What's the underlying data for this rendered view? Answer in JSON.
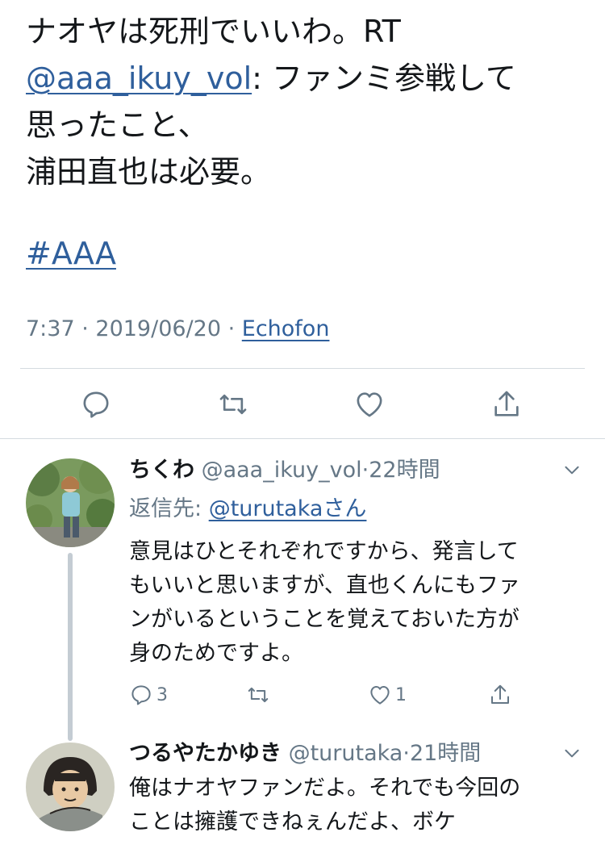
{
  "tweet": {
    "text_line1": "ナオヤは死刑でいいわ。RT",
    "mention": "@aaa_ikuy_vol",
    "text_line2_rest": ": ファンミ参戦して",
    "text_line3": "思ったこと、",
    "text_line4": "浦田直也は必要。",
    "hashtag": "#AAA",
    "time": "7:37",
    "sep1": " · ",
    "date": "2019/06/20",
    "sep2": " · ",
    "via": "Echofon"
  },
  "actions": {
    "reply_icon": "reply-icon",
    "retweet_icon": "retweet-icon",
    "like_icon": "heart-icon",
    "share_icon": "share-icon"
  },
  "replies": [
    {
      "name": "ちくわ",
      "handle": "@aaa_ikuy_vol",
      "dot": "·",
      "time": "22時間",
      "replying_prefix": "返信先: ",
      "replying_to": "@turutakaさん",
      "lines": [
        "意見はひとそれぞれですから、発言して",
        "もいいと思いますが、直也くんにもファ",
        "ンがいるということを覚えておいた方が",
        "身のためですよ。"
      ],
      "reply_count": "3",
      "retweet_count": "",
      "like_count": "1"
    },
    {
      "name": "つるやたかゆき",
      "handle": "@turutaka",
      "dot": "·",
      "time": "21時間",
      "lines": [
        "俺はナオヤファンだよ。それでも今回の",
        "ことは擁護できねぇんだよ、ボケ"
      ]
    }
  ],
  "colors": {
    "text": "#14171a",
    "secondary": "#657786",
    "link": "#2f5f9c",
    "divider": "#d5dbe0"
  }
}
